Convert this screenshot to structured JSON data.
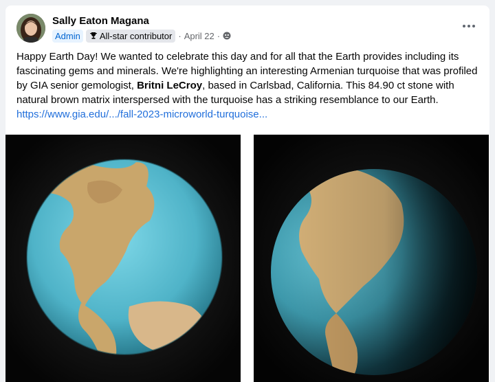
{
  "post": {
    "author": "Sally Eaton Magana",
    "role_badge": "Admin",
    "contributor_badge": "All-star contributor",
    "date": "April 22",
    "separator": "·",
    "text_part1": "Happy Earth Day! We wanted to celebrate this day and for all that the Earth provides including its fascinating gems and minerals. We're highlighting an interesting Armenian turquoise that was profiled by GIA senior gemologist, ",
    "text_bold": "Britni LeCroy",
    "text_part2": ", based in Carlsbad, California. This 84.90 ct stone with natural brown matrix interspersed with the turquoise has a striking resemblance to our Earth. ",
    "link": "https://www.gia.edu/.../fall-2023-microworld-turquoise..."
  },
  "icons": {
    "trophy": "trophy-icon",
    "privacy": "group-globe-icon",
    "more": "more-options-icon"
  },
  "colors": {
    "link": "#216fdb",
    "admin_badge_bg": "#e7f3ff",
    "admin_badge_text": "#0064d1",
    "turquoise": "#5ec3d6",
    "matrix": "#c9a66b"
  }
}
